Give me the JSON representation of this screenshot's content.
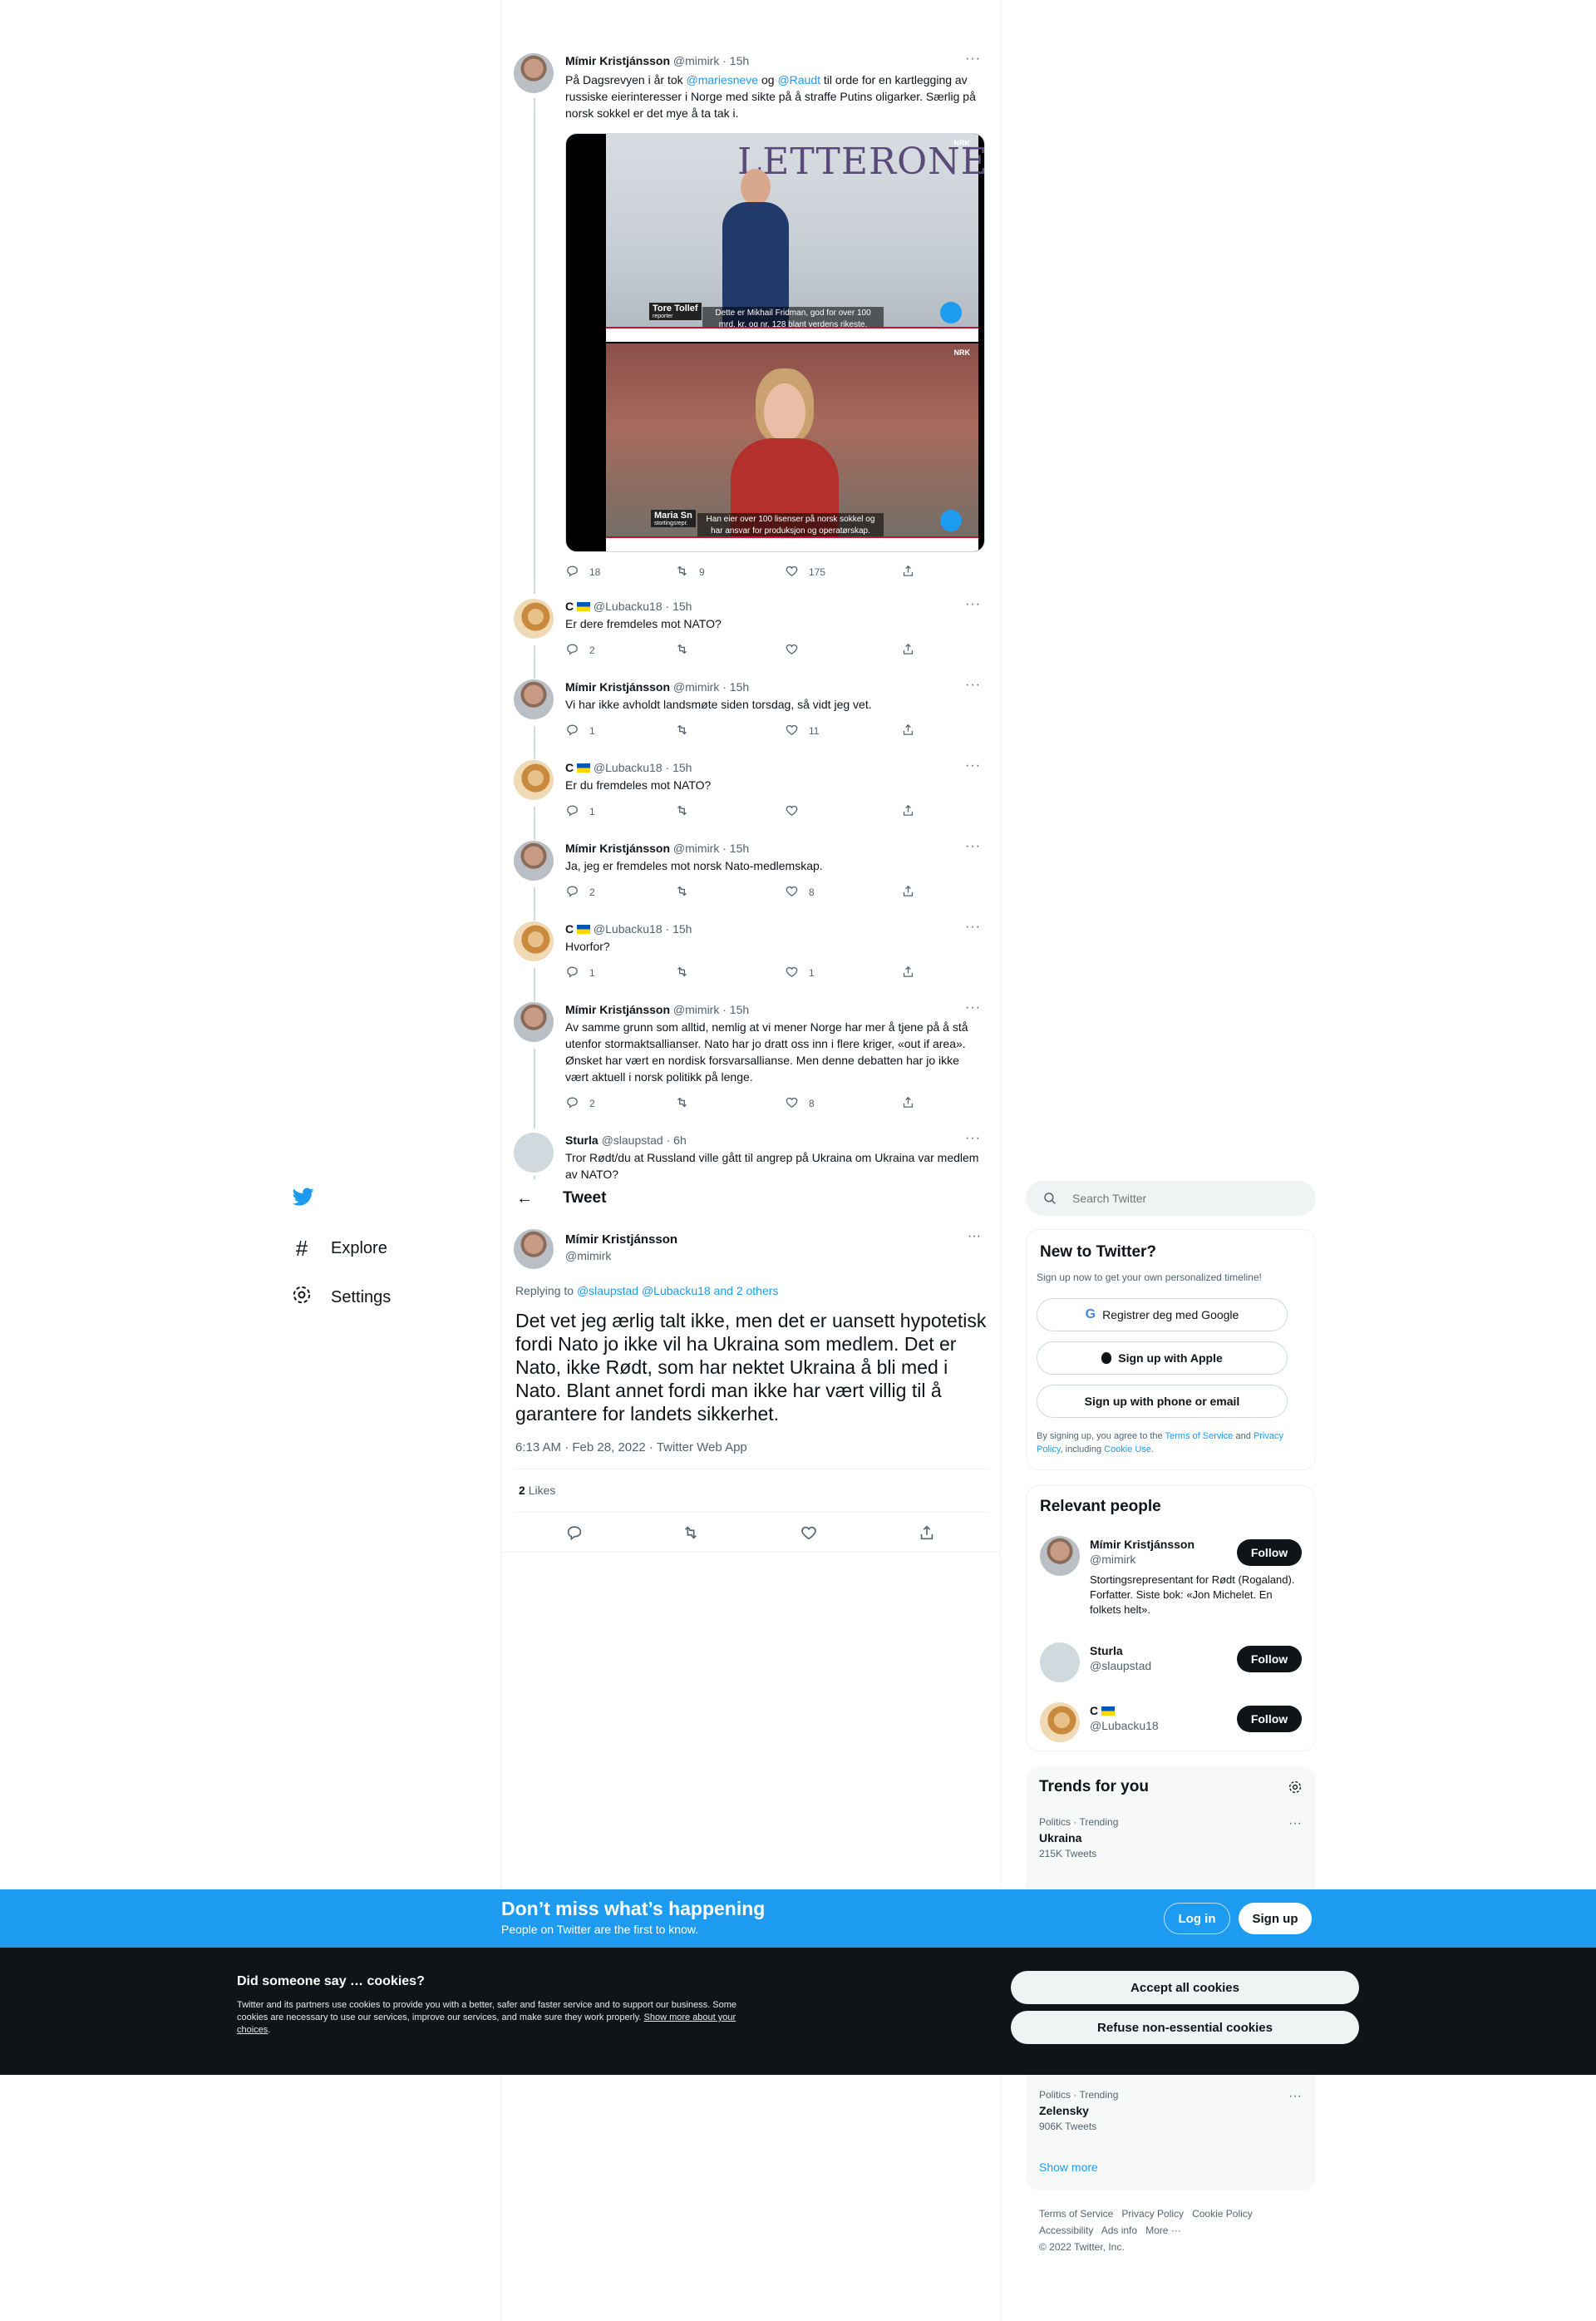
{
  "nav": {
    "explore_label": "Explore",
    "settings_label": "Settings"
  },
  "thread": {
    "first": {
      "name": "Mímir Kristjánsson",
      "handle": "@mimirk",
      "time": "· 15h",
      "text_part1": "På Dagsrevyen i år tok ",
      "mention1": "@mariesneve",
      "text_part2": " og ",
      "mention2": "@Raudt",
      "text_part3": " til orde for en kartlegging av russiske eierinteresser i Norge med sikte på å straffe Putins oligarker. Særlig på norsk sokkel er det mye å ta tak i.",
      "video": {
        "brand": "LETTERONE",
        "caption_top_name": "Tore Tollef",
        "caption_top_role": "reporter",
        "caption_top": "Dette er Mikhail Fridman, god for over 100 mrd. kr. og nr. 128 blant verdens rikeste.",
        "caption_bottom_name": "Maria Sn",
        "caption_bottom_role": "stortingsrepr.",
        "caption_bottom": "Han eier over 100 lisenser på norsk sokkel og har ansvar for produksjon og operatørskap.",
        "nrk": "NRK"
      },
      "replies": "18",
      "retweets": "9",
      "likes": "175"
    },
    "replies": [
      {
        "name": "C",
        "handle": "@Lubacku18",
        "time": "· 15h",
        "text": "Er dere fremdeles mot NATO?",
        "replies": "2",
        "retweets": "",
        "likes": ""
      },
      {
        "name": "Mímir Kristjánsson",
        "handle": "@mimirk",
        "time": "· 15h",
        "text": "Vi har ikke avholdt landsmøte siden torsdag, så vidt jeg vet.",
        "replies": "1",
        "retweets": "",
        "likes": "11"
      },
      {
        "name": "C",
        "handle": "@Lubacku18",
        "time": "· 15h",
        "text": "Er du fremdeles mot NATO?",
        "replies": "1",
        "retweets": "",
        "likes": ""
      },
      {
        "name": "Mímir Kristjánsson",
        "handle": "@mimirk",
        "time": "· 15h",
        "text": "Ja, jeg er fremdeles mot norsk Nato-medlemskap.",
        "replies": "2",
        "retweets": "",
        "likes": "8"
      },
      {
        "name": "C",
        "handle": "@Lubacku18",
        "time": "· 15h",
        "text": "Hvorfor?",
        "replies": "1",
        "retweets": "",
        "likes": "1"
      },
      {
        "name": "Mímir Kristjánsson",
        "handle": "@mimirk",
        "time": "· 15h",
        "text": "Av samme grunn som alltid, nemlig at vi mener Norge har mer å tjene på å stå utenfor stormaktsallianser. Nato har jo dratt oss inn i flere kriger, «out if area». Ønsket har vært en nordisk forsvarsallianse. Men denne debatten har jo ikke vært aktuell i norsk politikk på lenge.",
        "replies": "2",
        "retweets": "",
        "likes": "8"
      },
      {
        "name": "Sturla",
        "handle": "@slaupstad",
        "time": "· 6h",
        "text": "Tror Rødt/du at Russland ville gått til angrep på Ukraina om Ukraina var medlem av NATO?",
        "replies": "",
        "retweets": "",
        "likes": ""
      }
    ]
  },
  "header": {
    "title": "Tweet"
  },
  "main_tweet": {
    "name": "Mímir Kristjánsson",
    "handle": "@mimirk",
    "replying_label": "Replying to ",
    "replying_to": "@slaupstad @Lubacku18 and 2 others",
    "text": "Det vet jeg ærlig talt ikke, men det er uansett hypotetisk fordi Nato jo ikke vil ha Ukraina som medlem. Det er Nato, ikke Rødt, som har nektet Ukraina å bli med i Nato. Blant annet fordi man ikke har vært villig til å garantere for landets sikkerhet.",
    "meta": "6:13 AM · Feb 28, 2022 · Twitter Web App",
    "likes_count": "2",
    "likes_label": "Likes"
  },
  "search": {
    "placeholder": "Search Twitter"
  },
  "new_to_twitter": {
    "title": "New to Twitter?",
    "subtitle": "Sign up now to get your own personalized timeline!",
    "google": "Registrer deg med Google",
    "apple": "Sign up with Apple",
    "phone": "Sign up with phone or email",
    "legal_1": "By signing up, you agree to the ",
    "tos": "Terms of Service",
    "legal_2": " and ",
    "privacy": "Privacy Policy",
    "legal_3": ", including ",
    "cookie": "Cookie Use",
    "legal_4": "."
  },
  "relevant": {
    "title": "Relevant people",
    "people": [
      {
        "name": "Mímir Kristjánsson",
        "handle": "@mimirk",
        "bio": "Stortingsrepresentant for Rødt (Rogaland). Forfatter. Siste bok: «Jon Michelet. En folkets helt».",
        "button": "Follow"
      },
      {
        "name": "Sturla",
        "handle": "@slaupstad",
        "bio": "",
        "button": "Follow"
      },
      {
        "name": "C",
        "handle": "@Lubacku18",
        "bio": "",
        "button": "Follow"
      }
    ]
  },
  "trends": {
    "title": "Trends for you",
    "items": [
      {
        "context": "Politics · Trending",
        "name": "Ukraina",
        "count": "215K Tweets"
      },
      {
        "context": "Politics · Trending",
        "name": "Zelensky",
        "count": "906K Tweets"
      }
    ],
    "show_more": "Show more"
  },
  "footer": {
    "terms": "Terms of Service",
    "privacy": "Privacy Policy",
    "cookie": "Cookie Policy",
    "accessibility": "Accessibility",
    "ads": "Ads info",
    "more": "More ···",
    "copyright": "© 2022 Twitter, Inc."
  },
  "signup_bar": {
    "title": "Don’t miss what’s happening",
    "subtitle": "People on Twitter are the first to know.",
    "login": "Log in",
    "signup": "Sign up"
  },
  "cookies": {
    "title": "Did someone say … cookies?",
    "body": "Twitter and its partners use cookies to provide you with a better, safer and faster service and to support our business. Some cookies are necessary to use our services, improve our services, and make sure they work properly. ",
    "link": "Show more about your choices",
    "body_end": ".",
    "accept": "Accept all cookies",
    "refuse": "Refuse non-essential cookies"
  },
  "colors": {
    "brand_blue": "#1d9bf0",
    "text_primary": "#0f1419",
    "text_secondary": "#536471",
    "ukraine_blue": "#0057b7",
    "ukraine_yellow": "#ffd700"
  }
}
